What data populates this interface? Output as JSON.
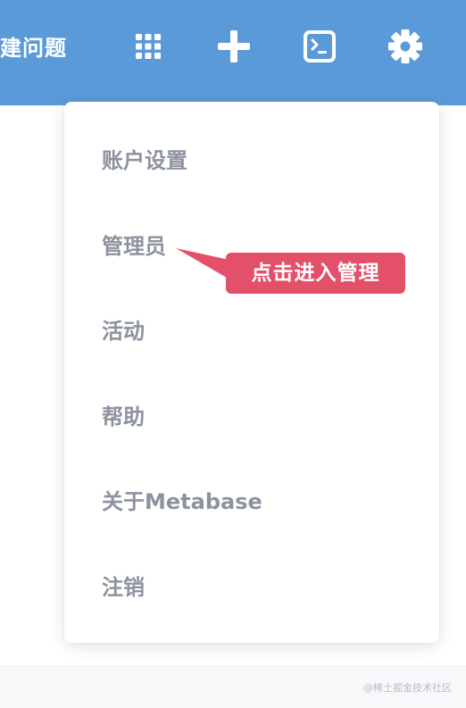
{
  "header": {
    "title": "建问题",
    "icons": [
      "grid-icon",
      "plus-icon",
      "terminal-icon",
      "gear-icon"
    ],
    "background": "#5b9ad8"
  },
  "menu": {
    "items": [
      {
        "label": "账户设置"
      },
      {
        "label": "管理员"
      },
      {
        "label": "活动"
      },
      {
        "label": "帮助"
      },
      {
        "label": "关于Metabase"
      },
      {
        "label": "注销"
      }
    ],
    "text_color": "#8d939e"
  },
  "callout": {
    "label": "点击进入管理",
    "color": "#e4506a"
  },
  "watermark": "@稀土掘金技术社区"
}
